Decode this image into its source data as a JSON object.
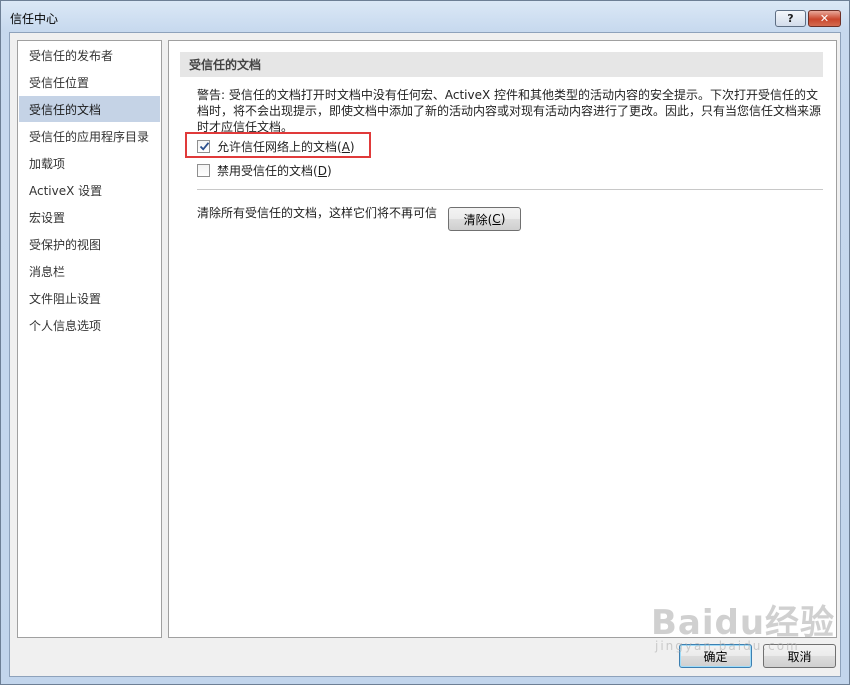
{
  "window": {
    "title": "信任中心",
    "help_label": "?",
    "close_label": "✕"
  },
  "nav": {
    "items": [
      {
        "label": "受信任的发布者"
      },
      {
        "label": "受信任位置"
      },
      {
        "label": "受信任的文档"
      },
      {
        "label": "受信任的应用程序目录"
      },
      {
        "label": "加载项"
      },
      {
        "label": "ActiveX 设置"
      },
      {
        "label": "宏设置"
      },
      {
        "label": "受保护的视图"
      },
      {
        "label": "消息栏"
      },
      {
        "label": "文件阻止设置"
      },
      {
        "label": "个人信息选项"
      }
    ],
    "selected_index": 2
  },
  "content": {
    "section_title": "受信任的文档",
    "warning_text": "警告: 受信任的文档打开时文档中没有任何宏、ActiveX 控件和其他类型的活动内容的安全提示。下次打开受信任的文档时，将不会出现提示，即使文档中添加了新的活动内容或对现有活动内容进行了更改。因此，只有当您信任文档来源时才应信任文档。",
    "allow_network": {
      "label": "允许信任网络上的文档(",
      "key": "A",
      "suffix": ")",
      "checked": true
    },
    "disable_trusted": {
      "label": "禁用受信任的文档(",
      "key": "D",
      "suffix": ")",
      "checked": false
    },
    "clear_text": "清除所有受信任的文档，这样它们将不再可信",
    "clear_button": {
      "label": "清除(",
      "key": "C",
      "suffix": ")"
    }
  },
  "footer": {
    "ok_label": "确定",
    "cancel_label": "取消"
  },
  "watermark": {
    "text": "Baidu经验",
    "sub": "jingyan.baidu.com"
  },
  "colors": {
    "selection": "#c5d3e6",
    "highlight_box": "#e03a3a"
  }
}
